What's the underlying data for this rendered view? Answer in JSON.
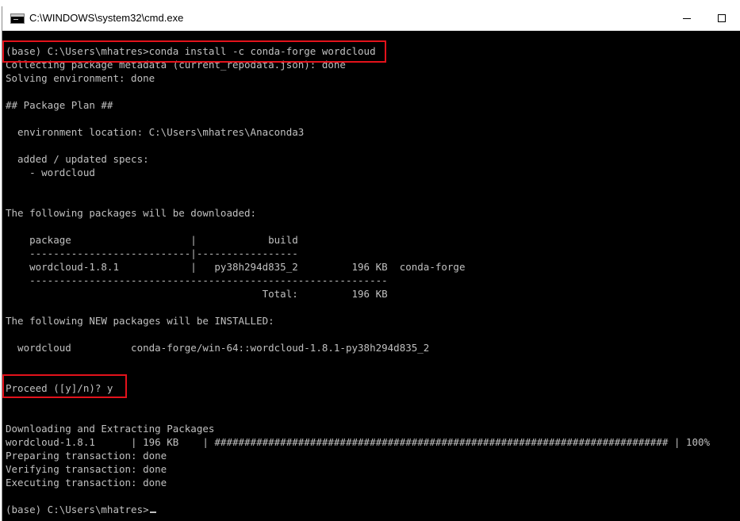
{
  "window": {
    "title": "C:\\WINDOWS\\system32\\cmd.exe",
    "icon": "console-icon",
    "controls": [
      "minimize",
      "maximize"
    ]
  },
  "console": {
    "lines": [
      "(base) C:\\Users\\mhatres>conda install -c conda-forge wordcloud",
      "Collecting package metadata (current_repodata.json): done",
      "Solving environment: done",
      "",
      "## Package Plan ##",
      "",
      "  environment location: C:\\Users\\mhatres\\Anaconda3",
      "",
      "  added / updated specs:",
      "    - wordcloud",
      "",
      "",
      "The following packages will be downloaded:",
      "",
      "    package                    |            build",
      "    ---------------------------|-----------------",
      "    wordcloud-1.8.1            |   py38h294d835_2         196 KB  conda-forge",
      "    ------------------------------------------------------------",
      "                                           Total:         196 KB",
      "",
      "The following NEW packages will be INSTALLED:",
      "",
      "  wordcloud          conda-forge/win-64::wordcloud-1.8.1-py38h294d835_2",
      "",
      "",
      "Proceed ([y]/n)? y",
      "",
      "",
      "Downloading and Extracting Packages",
      "wordcloud-1.8.1      | 196 KB    | ############################################################################ | 100%",
      "Preparing transaction: done",
      "Verifying transaction: done",
      "Executing transaction: done",
      "",
      "(base) C:\\Users\\mhatres>"
    ]
  },
  "colors": {
    "console_bg": "#000000",
    "console_text": "#c0c0c0",
    "highlight_box": "#e3121b",
    "titlebar_bg": "#ffffff"
  }
}
